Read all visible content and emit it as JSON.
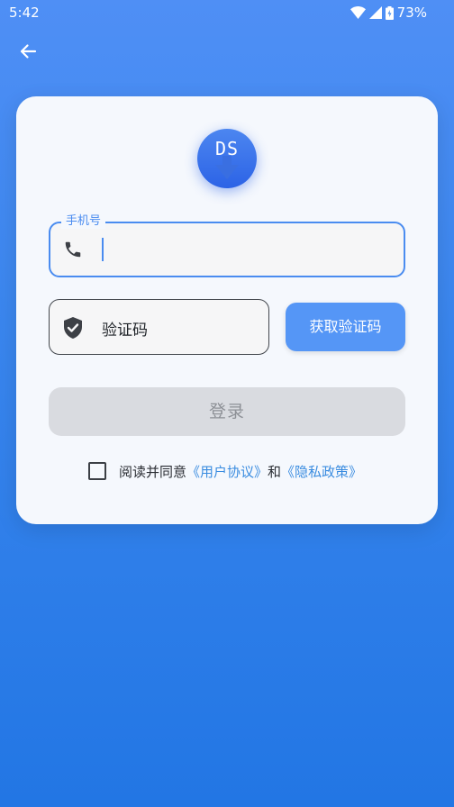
{
  "status_bar": {
    "time": "5:42",
    "battery": "73%",
    "icons": [
      "wifi-icon",
      "signal-icon",
      "battery-icon"
    ]
  },
  "nav": {
    "back_icon": "arrow-left-icon"
  },
  "logo": {
    "text": "DS"
  },
  "phone_field": {
    "label": "手机号",
    "value": "",
    "icon": "phone-icon"
  },
  "code_field": {
    "placeholder": "验证码",
    "icon": "shield-check-icon"
  },
  "get_code_button": {
    "label": "获取验证码"
  },
  "login_button": {
    "label": "登录"
  },
  "agreement": {
    "checked": false,
    "prefix": "阅读并同意",
    "user_agreement": "《用户协议》",
    "conjunction": "和",
    "privacy_policy": "《隐私政策》"
  },
  "colors": {
    "accent": "#4a8cf0",
    "button_blue": "#5596f6",
    "link": "#3a8ce0",
    "disabled_button": "#d9dbe0"
  }
}
